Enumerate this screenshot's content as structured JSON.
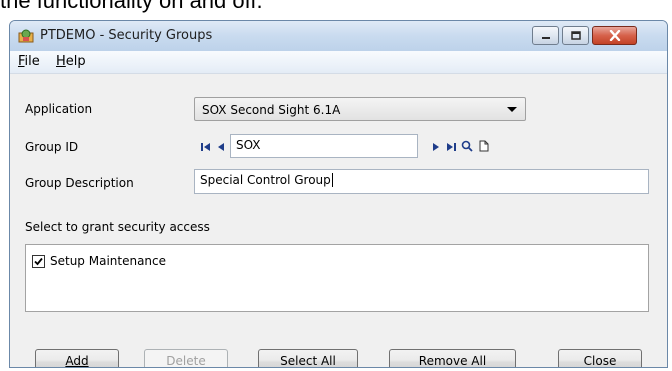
{
  "caption": "the functionality on and off.",
  "window": {
    "title": "PTDEMO - Security Groups",
    "icon": "app-icon",
    "controls": [
      "minimize-icon",
      "maximize-icon",
      "close-icon"
    ]
  },
  "menu": {
    "file": "File",
    "help": "Help"
  },
  "form": {
    "application_label": "Application",
    "application_value": "SOX Second Sight 6.1A",
    "group_id_label": "Group ID",
    "group_id_value": "SOX",
    "group_desc_label": "Group Description",
    "group_desc_value": "Special Control Group",
    "grant_label": "Select to grant security access"
  },
  "access_list": [
    {
      "label": "Setup Maintenance",
      "checked": true
    }
  ],
  "buttons": {
    "add": "Add",
    "delete": "Delete",
    "select_all": "Select All",
    "remove_all": "Remove All",
    "close": "Close"
  },
  "colors": {
    "titlebar": "#c9dbef",
    "close_button": "#c34226",
    "window_bg": "#f0f0f0"
  }
}
